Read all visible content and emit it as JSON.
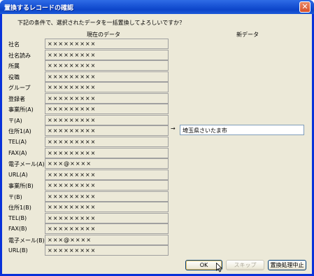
{
  "window": {
    "title": "置換するレコードの確認"
  },
  "prompt": "下記の条件で、選択されたデータを一括置換してよろしいですか？",
  "columns": {
    "current": "現在のデータ",
    "new": "新データ"
  },
  "rows": [
    {
      "label": "社名",
      "value": "×××××××××"
    },
    {
      "label": "社名読み",
      "value": "×××××××××"
    },
    {
      "label": "所属",
      "value": "×××××××××"
    },
    {
      "label": "役職",
      "value": "×××××××××"
    },
    {
      "label": "グループ",
      "value": "×××××××××"
    },
    {
      "label": "登録者",
      "value": "×××××××××"
    },
    {
      "label": "事業所(A)",
      "value": "×××××××××"
    },
    {
      "label": "〒(A)",
      "value": "×××××××××"
    },
    {
      "label": "住所1(A)",
      "value": "×××××××××"
    },
    {
      "label": "TEL(A)",
      "value": "×××××××××"
    },
    {
      "label": "FAX(A)",
      "value": "×××××××××"
    },
    {
      "label": "電子メール(A)",
      "value": "×××@××××"
    },
    {
      "label": "URL(A)",
      "value": "×××××××××"
    },
    {
      "label": "事業所(B)",
      "value": "×××××××××"
    },
    {
      "label": "〒(B)",
      "value": "×××××××××"
    },
    {
      "label": "住所1(B)",
      "value": "×××××××××"
    },
    {
      "label": "TEL(B)",
      "value": "×××××××××"
    },
    {
      "label": "FAX(B)",
      "value": "×××××××××"
    },
    {
      "label": "電子メール(B)",
      "value": "×××@××××"
    },
    {
      "label": "URL(B)",
      "value": "×××××××××"
    }
  ],
  "new_data": {
    "arrow": "→",
    "value": "埼玉県さいたま市"
  },
  "buttons": {
    "ok": "OK",
    "skip": "スキップ",
    "stop": "置換処理中止"
  },
  "colors": {
    "title_bar": "#0d45c9",
    "dialog_bg": "#ece9d8",
    "close_button": "#d9502a"
  },
  "icons": {
    "close": "close-icon",
    "cursor": "mouse-pointer-icon"
  }
}
